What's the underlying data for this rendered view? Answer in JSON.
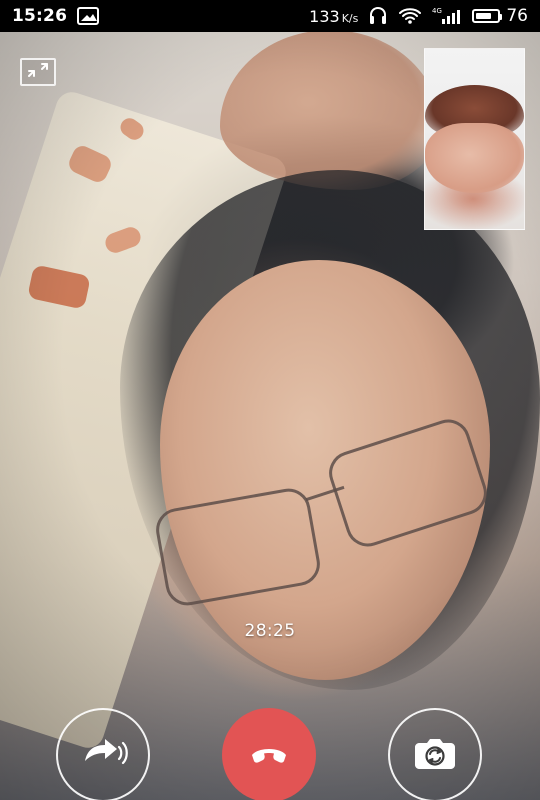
{
  "status_bar": {
    "time": "15:26",
    "net_rate_value": "133",
    "net_rate_unit": "K/s",
    "network_label": "4G",
    "battery_percent": 76
  },
  "call": {
    "timer": "28:25",
    "button_labels": {
      "audio": "",
      "hangup": "",
      "camera": ""
    }
  },
  "colors": {
    "hangup": "#e25454",
    "white": "#ffffff"
  },
  "icons": {
    "minimize": "minimize-icon",
    "audio": "switch-to-audio-icon",
    "hangup": "phone-hangup-icon",
    "camera": "switch-camera-icon"
  }
}
